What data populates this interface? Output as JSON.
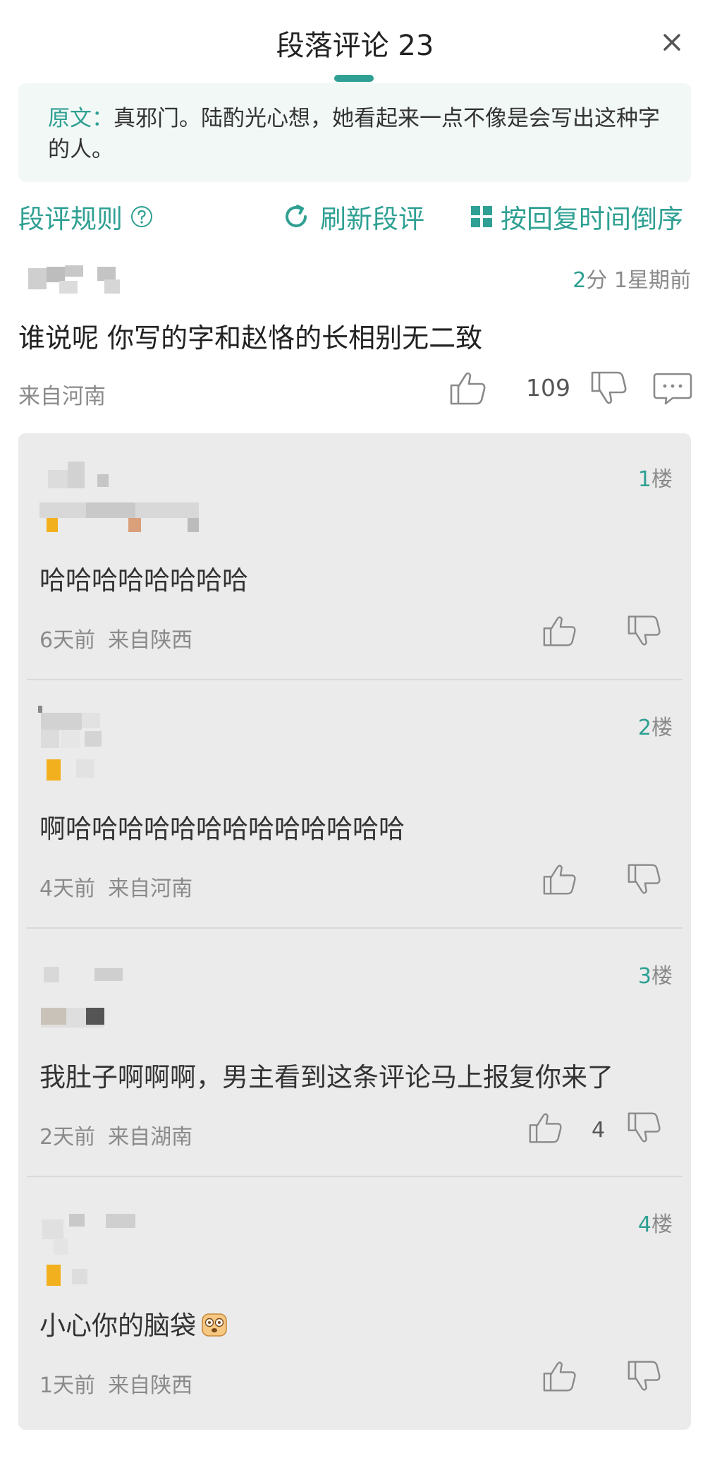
{
  "header": {
    "title": "段落评论 23"
  },
  "quote": {
    "label": "原文：",
    "text": "真邪门。陆酌光心想，她看起来一点不像是会写出这种字的人。"
  },
  "toolbar": {
    "rules": "段评规则",
    "refresh": "刷新段评",
    "sort": "按回复时间倒序"
  },
  "main_comment": {
    "time_num": "2",
    "time_rest": "分  1星期前",
    "text": "谁说呢 你写的字和赵恪的长相别无二致",
    "location": "来自河南",
    "likes": "109"
  },
  "replies": [
    {
      "floor_num": "1",
      "floor_suffix": "楼",
      "text": "哈哈哈哈哈哈哈哈",
      "time": "6天前",
      "location": "来自陕西",
      "likes": ""
    },
    {
      "floor_num": "2",
      "floor_suffix": "楼",
      "text": "啊哈哈哈哈哈哈哈哈哈哈哈哈哈",
      "time": "4天前",
      "location": "来自河南",
      "likes": ""
    },
    {
      "floor_num": "3",
      "floor_suffix": "楼",
      "text": "我肚子啊啊啊，男主看到这条评论马上报复你来了",
      "time": "2天前",
      "location": "来自湖南",
      "likes": "4"
    },
    {
      "floor_num": "4",
      "floor_suffix": "楼",
      "text": "小心你的脑袋",
      "time": "1天前",
      "location": "来自陕西",
      "likes": ""
    }
  ],
  "colors": {
    "accent": "#2fa093",
    "reply_bg": "#ebebeb",
    "quote_bg": "#f1f8f6"
  },
  "icons": [
    "close-icon",
    "question-circle-icon",
    "refresh-icon",
    "grid-sort-icon",
    "thumb-up-icon",
    "thumb-down-icon",
    "comment-bubble-icon",
    "emoji-icon"
  ]
}
